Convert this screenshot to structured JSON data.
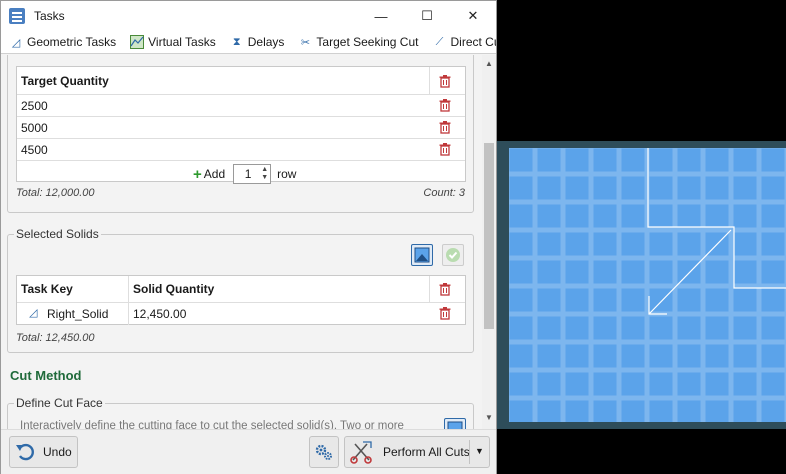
{
  "window": {
    "title": "Tasks",
    "minimize_glyph": "—",
    "maximize_glyph": "☐",
    "close_glyph": "✕"
  },
  "tabs": [
    {
      "label": "Geometric Tasks",
      "icon": "geometric-icon"
    },
    {
      "label": "Virtual Tasks",
      "icon": "virtual-icon"
    },
    {
      "label": "Delays",
      "icon": "hourglass-icon"
    },
    {
      "label": "Target Seeking Cut",
      "icon": "target-cut-icon"
    },
    {
      "label": "Direct Cut",
      "icon": "direct-cut-icon"
    }
  ],
  "target_table": {
    "header": "Target Quantity",
    "rows": [
      "2500",
      "5000",
      "4500"
    ],
    "add_label": "Add",
    "add_count": "1",
    "row_label": "row",
    "total": "Total: 12,000.00",
    "count": "Count: 3"
  },
  "selected_solids": {
    "legend": "Selected Solids",
    "col_task_key": "Task Key",
    "col_solid_qty": "Solid Quantity",
    "rows": [
      {
        "task_key": "Right_Solid",
        "solid_quantity": "12,450.00"
      }
    ],
    "total": "Total: 12,450.00"
  },
  "cut_method": {
    "title": "Cut Method",
    "define_legend": "Define Cut Face",
    "description": "Interactively define the cutting face to cut the selected solid(s). Two or more"
  },
  "bottom": {
    "undo_label": "Undo",
    "perform_label": "Perform All Cuts"
  },
  "colors": {
    "accent": "#1f6a3a",
    "trash": "#c0393b",
    "mesh_fill": "#5ba3ea",
    "mesh_lines": "#7db6ee",
    "mesh_border": "#2e4d5a"
  }
}
